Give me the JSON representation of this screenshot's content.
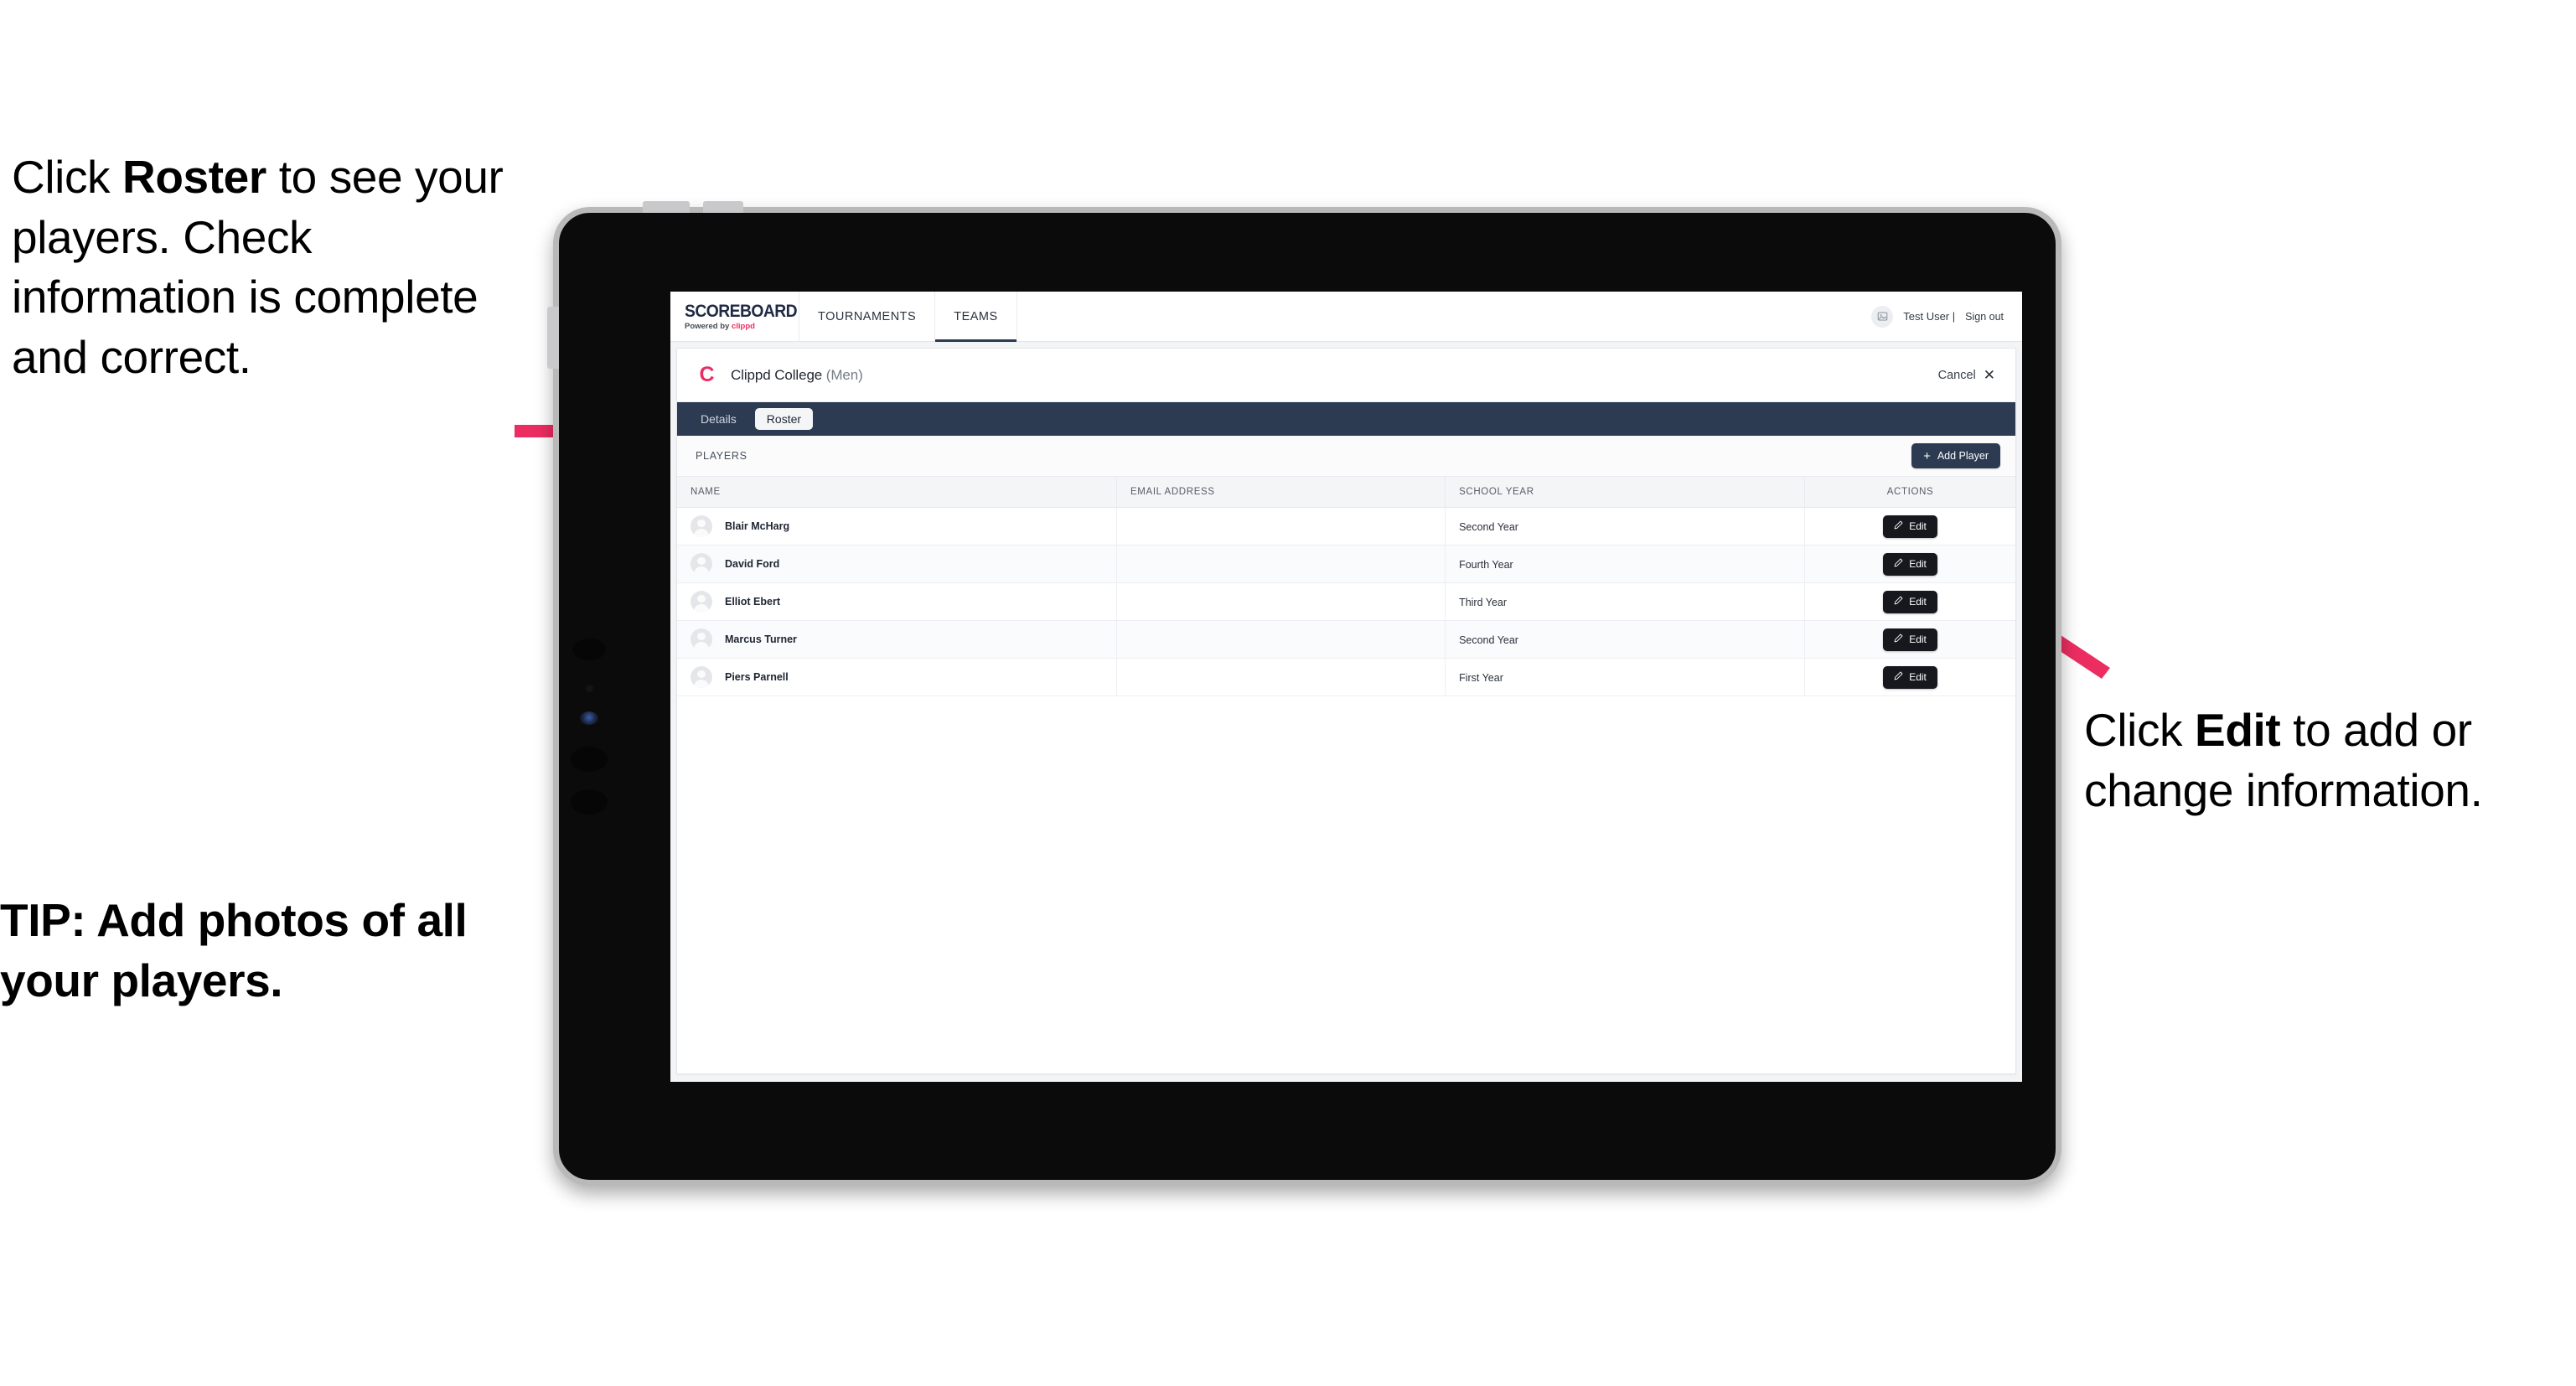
{
  "annotations": {
    "left_top": {
      "line1_pre": "Click ",
      "line1_bold": "Roster",
      "line1_post": " to see your players. Check information is complete and correct."
    },
    "left_tip": "TIP: Add photos of all your players.",
    "right": {
      "line1_pre": "Click ",
      "line1_bold": "Edit",
      "line1_post": " to add or change information."
    }
  },
  "app": {
    "brand": {
      "wordmark": "SCOREBOARD",
      "powered_pre": "Powered by ",
      "powered_brand": "clippd"
    },
    "nav_tabs": [
      {
        "label": "TOURNAMENTS",
        "active": false
      },
      {
        "label": "TEAMS",
        "active": true
      }
    ],
    "account": {
      "avatar_icon": "user-photo-icon",
      "user_label": "Test User |",
      "sign_out_label": "Sign out"
    },
    "team_header": {
      "logo_letter": "C",
      "name": "Clippd College ",
      "name_suffix": "(Men)",
      "cancel_label": "Cancel",
      "close_icon": "✕"
    },
    "sub_tabs": [
      {
        "label": "Details",
        "active": false
      },
      {
        "label": "Roster",
        "active": true
      }
    ],
    "players_toolbar": {
      "title": "PLAYERS",
      "add_button_plus": "+",
      "add_button_label": "Add Player"
    },
    "table": {
      "columns": [
        "NAME",
        "EMAIL ADDRESS",
        "SCHOOL YEAR",
        "ACTIONS"
      ],
      "edit_label": "Edit",
      "rows": [
        {
          "name": "Blair McHarg",
          "email": "",
          "school_year": "Second Year"
        },
        {
          "name": "David Ford",
          "email": "",
          "school_year": "Fourth Year"
        },
        {
          "name": "Elliot Ebert",
          "email": "",
          "school_year": "Third Year"
        },
        {
          "name": "Marcus Turner",
          "email": "",
          "school_year": "Second Year"
        },
        {
          "name": "Piers Parnell",
          "email": "",
          "school_year": "First Year"
        }
      ]
    }
  },
  "colors": {
    "accent_pink": "#ec2d62",
    "navy": "#2c3a52",
    "dark_button": "#16181d",
    "device_body": "#0b0b0b",
    "device_bezel": "#b9b9ba"
  }
}
